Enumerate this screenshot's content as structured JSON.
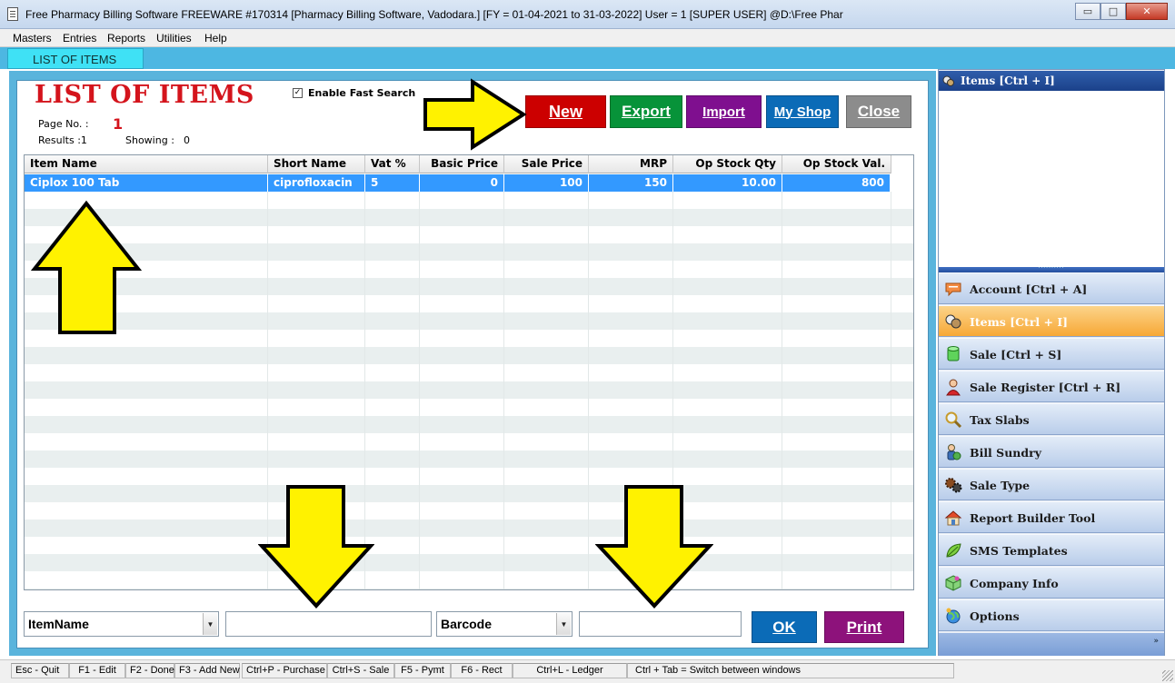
{
  "window": {
    "title": "Free Pharmacy Billing Software FREEWARE   #170314   [Pharmacy Billing Software, Vadodara.] [FY = 01-04-2021 to 31-03-2022] User = 1 [SUPER USER]  @D:\\Free Phar",
    "controls": {
      "minimize": "▭",
      "maximize": "□",
      "close": "✕"
    }
  },
  "menu": [
    "Masters",
    "Entries",
    "Reports",
    "Utilities",
    "Help"
  ],
  "tab": {
    "label": "LIST OF ITEMS"
  },
  "page": {
    "heading": "LIST OF ITEMS",
    "fast_search_label": "Enable Fast Search",
    "fast_search_checked": true,
    "page_no_label": "Page No. :",
    "page_no_value": "1",
    "results_label": "Results :1",
    "showing_label": "Showing :",
    "showing_value": "0"
  },
  "buttons": {
    "new": "New",
    "export": "Export",
    "import": "Import",
    "myshop": "My Shop",
    "close": "Close",
    "ok": "OK",
    "print": "Print"
  },
  "colors": {
    "new": "#cc0000",
    "export": "#079339",
    "import": "#7f0f8f",
    "myshop": "#0b6bb7",
    "close": "#8c8c8c",
    "ok": "#0b6bb7",
    "print": "#8d127b",
    "heading": "#d4141c",
    "selected_row": "#3399ff",
    "arrow": "#fff200"
  },
  "grid": {
    "columns": [
      "Item Name",
      "Short Name",
      "Vat %",
      "Basic Price",
      "Sale Price",
      "MRP",
      "Op Stock Qty",
      "Op Stock Val."
    ],
    "rows": [
      [
        "Ciplox 100 Tab",
        "ciprofloxacin",
        "5",
        "0",
        "100",
        "150",
        "10.00",
        "800"
      ]
    ]
  },
  "filters": {
    "field1": "ItemName",
    "field1_text": "",
    "field2": "Barcode",
    "field2_text": ""
  },
  "sidebar": {
    "header": "Items [Ctrl + I]",
    "items": [
      {
        "label": "Account [Ctrl + A]",
        "icon": "speech-bubble-icon",
        "active": false
      },
      {
        "label": "Items [Ctrl + I]",
        "icon": "pills-icon",
        "active": true
      },
      {
        "label": "Sale [Ctrl + S]",
        "icon": "cylinder-icon",
        "active": false
      },
      {
        "label": "Sale Register [Ctrl + R]",
        "icon": "user-icon",
        "active": false
      },
      {
        "label": "Tax Slabs",
        "icon": "magnifier-icon",
        "active": false
      },
      {
        "label": "Bill Sundry",
        "icon": "person-globe-icon",
        "active": false
      },
      {
        "label": "Sale Type",
        "icon": "gears-icon",
        "active": false
      },
      {
        "label": "Report Builder Tool",
        "icon": "home-icon",
        "active": false
      },
      {
        "label": "SMS Templates",
        "icon": "leaf-icon",
        "active": false
      },
      {
        "label": "Company Info",
        "icon": "cube-icon",
        "active": false
      },
      {
        "label": "Options",
        "icon": "globe-icon",
        "active": false
      }
    ],
    "footer_chevron": "»"
  },
  "statusbar": [
    "Esc - Quit",
    "F1 - Edit",
    "F2 - Done",
    "F3 - Add New",
    "Ctrl+P - Purchase",
    "Ctrl+S - Sale",
    "F5 - Pymt",
    "F6 - Rect",
    "Ctrl+L - Ledger",
    "Ctrl + Tab = Switch between windows"
  ]
}
